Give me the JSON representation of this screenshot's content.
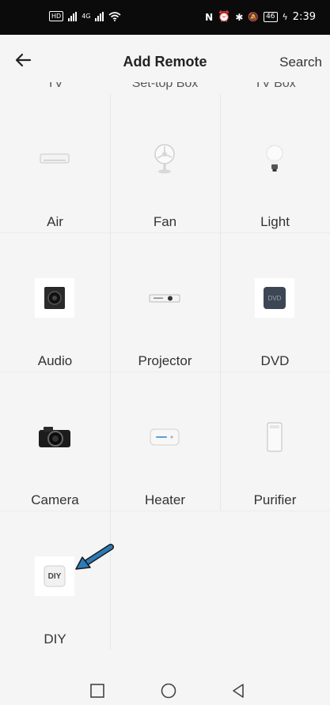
{
  "status_bar": {
    "hd_label": "HD",
    "network_4g": "4G",
    "battery": "46",
    "time": "2:39"
  },
  "header": {
    "title": "Add Remote",
    "search_label": "Search",
    "back_icon": "arrow-left-icon"
  },
  "cut_off_row": [
    "TV",
    "Set-top Box",
    "TV Box"
  ],
  "devices": [
    {
      "label": "Air",
      "icon": "air-conditioner-icon"
    },
    {
      "label": "Fan",
      "icon": "fan-icon"
    },
    {
      "label": "Light",
      "icon": "light-bulb-icon"
    },
    {
      "label": "Audio",
      "icon": "speaker-icon"
    },
    {
      "label": "Projector",
      "icon": "projector-icon"
    },
    {
      "label": "DVD",
      "icon": "dvd-icon"
    },
    {
      "label": "Camera",
      "icon": "camera-icon"
    },
    {
      "label": "Heater",
      "icon": "heater-icon"
    },
    {
      "label": "Purifier",
      "icon": "purifier-icon"
    },
    {
      "label": "DIY",
      "icon": "diy-icon",
      "icon_text": "DIY"
    }
  ],
  "annotation": {
    "icon": "arrow-pointer-icon",
    "color": "#2b7bb9"
  },
  "nav_bar": [
    "square-icon",
    "circle-icon",
    "triangle-back-icon"
  ]
}
